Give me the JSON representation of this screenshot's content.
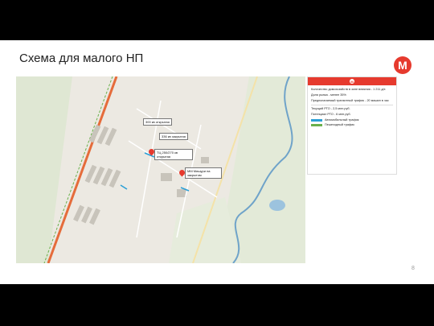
{
  "slide": {
    "title": "Схема для малого НП",
    "page_number": "8",
    "logo_letter": "M"
  },
  "map": {
    "callouts": [
      {
        "text": "300 кв открытая"
      },
      {
        "text": "336 кв закрытая"
      },
      {
        "text": "ТЦ 250/270 кв открытая"
      },
      {
        "text": "ММ Мишури на закрытом"
      }
    ]
  },
  "panel": {
    "logo_letter": "M",
    "lines": [
      "Количество домохозяйств в зоне влияния - 1 211 д/х",
      "Доля рынка - менее 35%",
      "Предполагаемый транзитный трафик - 20 машин в час",
      "Текущий РТО - 2,5 млн.руб.",
      "Потенциал РТО - 6 млн.руб."
    ],
    "legend": [
      {
        "label": "Автомобильный трафик",
        "color": "#2a9fd6"
      },
      {
        "label": "Пешеходный трафик",
        "color": "#6ab04c"
      }
    ]
  },
  "colors": {
    "brand": "#e63a2e",
    "road_main": "#e56c3b",
    "river": "#6fa3c9",
    "green_area": "#c9dcb9"
  }
}
